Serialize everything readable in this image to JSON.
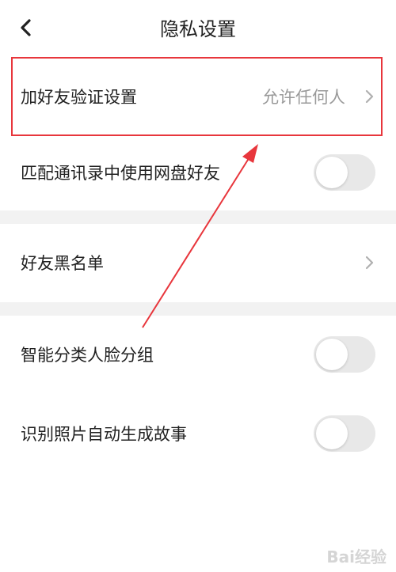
{
  "header": {
    "title": "隐私设置",
    "back_icon": "back-arrow-icon"
  },
  "rows": [
    {
      "label": "加好友验证设置",
      "value": "允许任何人",
      "control": "chevron"
    },
    {
      "label": "匹配通讯录中使用网盘好友",
      "control": "toggle",
      "enabled": false
    },
    {
      "label": "好友黑名单",
      "control": "chevron"
    },
    {
      "label": "智能分类人脸分组",
      "control": "toggle",
      "enabled": false
    },
    {
      "label": "识别照片自动生成故事",
      "control": "toggle",
      "enabled": false
    }
  ],
  "annotation": {
    "highlight_color": "#e8363c"
  },
  "watermark": "Bai经验"
}
